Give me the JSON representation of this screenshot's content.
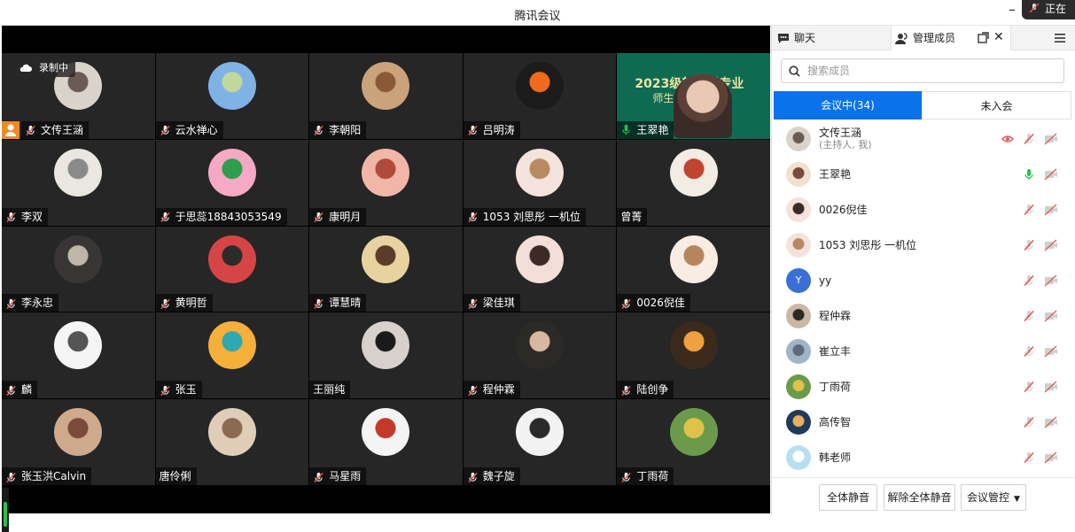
{
  "window": {
    "title": "腾讯会议",
    "status_text": "正在"
  },
  "recording": {
    "label": "录制中"
  },
  "tiles": [
    {
      "name": "文传王涵",
      "muted": true,
      "avatar": "avatar-ink-portrait"
    },
    {
      "name": "云水禅心",
      "muted": true,
      "avatar": "avatar-landscape"
    },
    {
      "name": "李朝阳",
      "muted": true,
      "avatar": "avatar-cartoon"
    },
    {
      "name": "吕明涛",
      "muted": true,
      "avatar": "avatar-flower"
    },
    {
      "name": "王翠艳",
      "muted": false,
      "avatar": "video-feed"
    },
    {
      "name": "李双",
      "muted": true,
      "avatar": "avatar-ink-painting"
    },
    {
      "name": "于思蕊18843053549",
      "muted": true,
      "avatar": "avatar-cartoon-green"
    },
    {
      "name": "康明月",
      "muted": true,
      "avatar": "avatar-girl-flowers"
    },
    {
      "name": "1053 刘思彤 一机位",
      "muted": true,
      "avatar": "avatar-cat-girl"
    },
    {
      "name": "曾菁",
      "muted": false,
      "avatar": "avatar-calligraphy"
    },
    {
      "name": "李永忠",
      "muted": true,
      "avatar": "avatar-room"
    },
    {
      "name": "黄明哲",
      "muted": true,
      "avatar": "avatar-man-glasses"
    },
    {
      "name": "谭慧晴",
      "muted": true,
      "avatar": "avatar-girl-dark"
    },
    {
      "name": "梁佳琪",
      "muted": true,
      "avatar": "avatar-girl-bangs"
    },
    {
      "name": "0026倪佳",
      "muted": true,
      "avatar": "avatar-girl-light"
    },
    {
      "name": "麟",
      "muted": true,
      "avatar": "avatar-sketch-guitar"
    },
    {
      "name": "张玉",
      "muted": true,
      "avatar": "avatar-sunset-beach"
    },
    {
      "name": "王丽纯",
      "muted": false,
      "avatar": "avatar-girl-black"
    },
    {
      "name": "程仲霖",
      "muted": true,
      "avatar": "avatar-man-suit"
    },
    {
      "name": "陆创争",
      "muted": true,
      "avatar": "avatar-sea-sunset"
    },
    {
      "name": "张玉洪Calvin",
      "muted": true,
      "avatar": "avatar-child"
    },
    {
      "name": "唐伶俐",
      "muted": false,
      "avatar": "avatar-girl-blonde"
    },
    {
      "name": "马星雨",
      "muted": true,
      "avatar": "avatar-mermaid"
    },
    {
      "name": "魏子旋",
      "muted": true,
      "avatar": "avatar-girl-white"
    },
    {
      "name": "丁雨荷",
      "muted": true,
      "avatar": "avatar-garden"
    }
  ],
  "active_tile": {
    "banner_line1": "2023级新…播专业",
    "banner_line2": "师生…会"
  },
  "panel": {
    "tab_chat": "聊天",
    "tab_members": "管理成员",
    "search_placeholder": "搜索成员",
    "seg_in": "会议中(34)",
    "seg_out": "未入会",
    "members": [
      {
        "name": "文传王涵",
        "sub": "(主持人, 我)",
        "mic": "off",
        "rec": true
      },
      {
        "name": "王翠艳",
        "sub": "",
        "mic": "on",
        "rec": false
      },
      {
        "name": "0026倪佳",
        "sub": "",
        "mic": "off",
        "rec": false
      },
      {
        "name": "1053 刘思彤 一机位",
        "sub": "",
        "mic": "off",
        "rec": false
      },
      {
        "name": "yy",
        "sub": "",
        "mic": "off",
        "rec": false,
        "initial": "Y"
      },
      {
        "name": "程仲霖",
        "sub": "",
        "mic": "off",
        "rec": false
      },
      {
        "name": "崔立丰",
        "sub": "",
        "mic": "off",
        "rec": false
      },
      {
        "name": "丁雨荷",
        "sub": "",
        "mic": "off",
        "rec": false
      },
      {
        "name": "高传智",
        "sub": "",
        "mic": "off",
        "rec": false
      },
      {
        "name": "韩老师",
        "sub": "",
        "mic": "off",
        "rec": false
      }
    ],
    "btn_mute_all": "全体静音",
    "btn_unmute_all": "解除全体静音",
    "btn_control": "会议管控"
  },
  "colors": {
    "accent": "#0a73eb",
    "tile_bg": "#262626",
    "host_badge": "#f08a24",
    "mic_on": "#29c24a",
    "mic_off": "#e15757"
  }
}
